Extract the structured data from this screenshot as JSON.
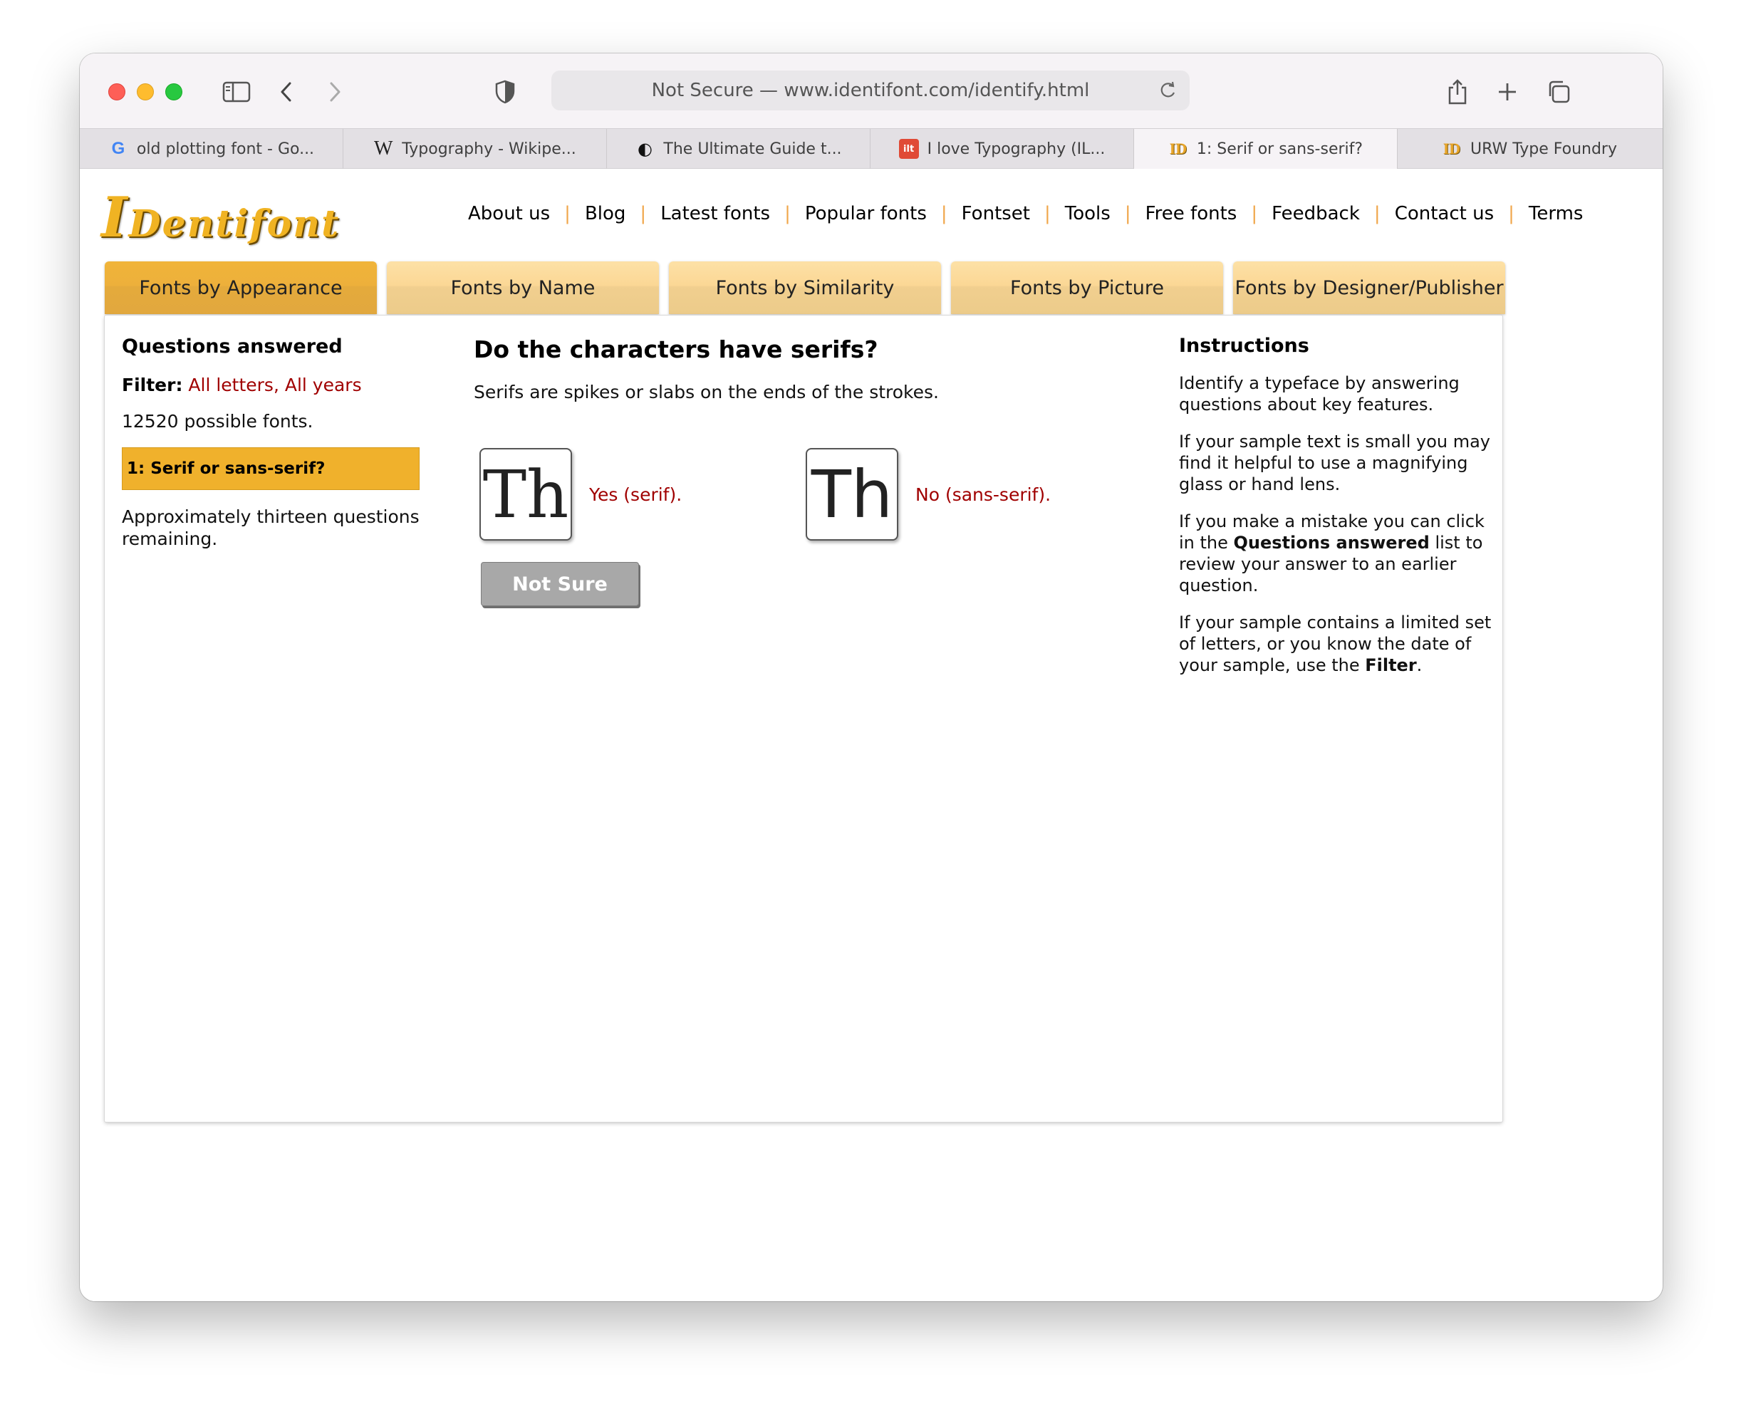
{
  "browser": {
    "url_display": "Not Secure — www.identifont.com/identify.html",
    "tabs": [
      {
        "title": "old plotting font - Go...",
        "icon": "google-favicon"
      },
      {
        "title": "Typography - Wikipe...",
        "icon": "wikipedia-favicon"
      },
      {
        "title": "The Ultimate Guide t...",
        "icon": "site-favicon"
      },
      {
        "title": "I love Typography (IL...",
        "icon": "ilt-favicon"
      },
      {
        "title": "1: Serif or sans-serif?",
        "icon": "identifont-favicon",
        "active": true
      },
      {
        "title": "URW Type Foundry",
        "icon": "identifont-favicon"
      }
    ],
    "favicon_text": {
      "google": "G",
      "wikipedia": "W",
      "site": "◐",
      "ilt": "ilt",
      "identifont": "ID"
    }
  },
  "site": {
    "logo_text": {
      "initial": "I",
      "rest": "Dentifont"
    },
    "nav": [
      "About us",
      "Blog",
      "Latest fonts",
      "Popular fonts",
      "Fontset",
      "Tools",
      "Free fonts",
      "Feedback",
      "Contact us",
      "Terms"
    ],
    "nav_separator": "|",
    "section_tabs": [
      "Fonts by Appearance",
      "Fonts by Name",
      "Fonts by Similarity",
      "Fonts by Picture",
      "Fonts by Designer/Publisher"
    ],
    "active_section": "Fonts by Appearance",
    "accent_color": "#f0b12c",
    "link_color": "#a00000"
  },
  "left": {
    "heading": "Questions answered",
    "filter_label": "Filter:",
    "filter_value": "All letters, All years",
    "possible": "12520 possible fonts.",
    "current_question": "1: Serif or sans-serif?",
    "remaining": "Approximately thirteen questions remaining."
  },
  "main": {
    "question": "Do the characters have serifs?",
    "description": "Serifs are spikes or slabs on the ends of the strokes.",
    "sample_text": "Th",
    "answer_yes": "Yes (serif).",
    "answer_no": "No (sans-serif).",
    "not_sure": "Not Sure"
  },
  "instructions": {
    "heading": "Instructions",
    "p1": "Identify a typeface by answering questions about key features.",
    "p2": "If your sample text is small you may find it helpful to use a magnifying glass or hand lens.",
    "p3_pre": "If you make a mistake you can click in the ",
    "p3_bold": "Questions answered",
    "p3_post": " list to review your answer to an earlier question.",
    "p4_pre": "If your sample contains a limited set of letters, or you know the date of your sample, use the ",
    "p4_bold": "Filter",
    "p4_post": "."
  }
}
